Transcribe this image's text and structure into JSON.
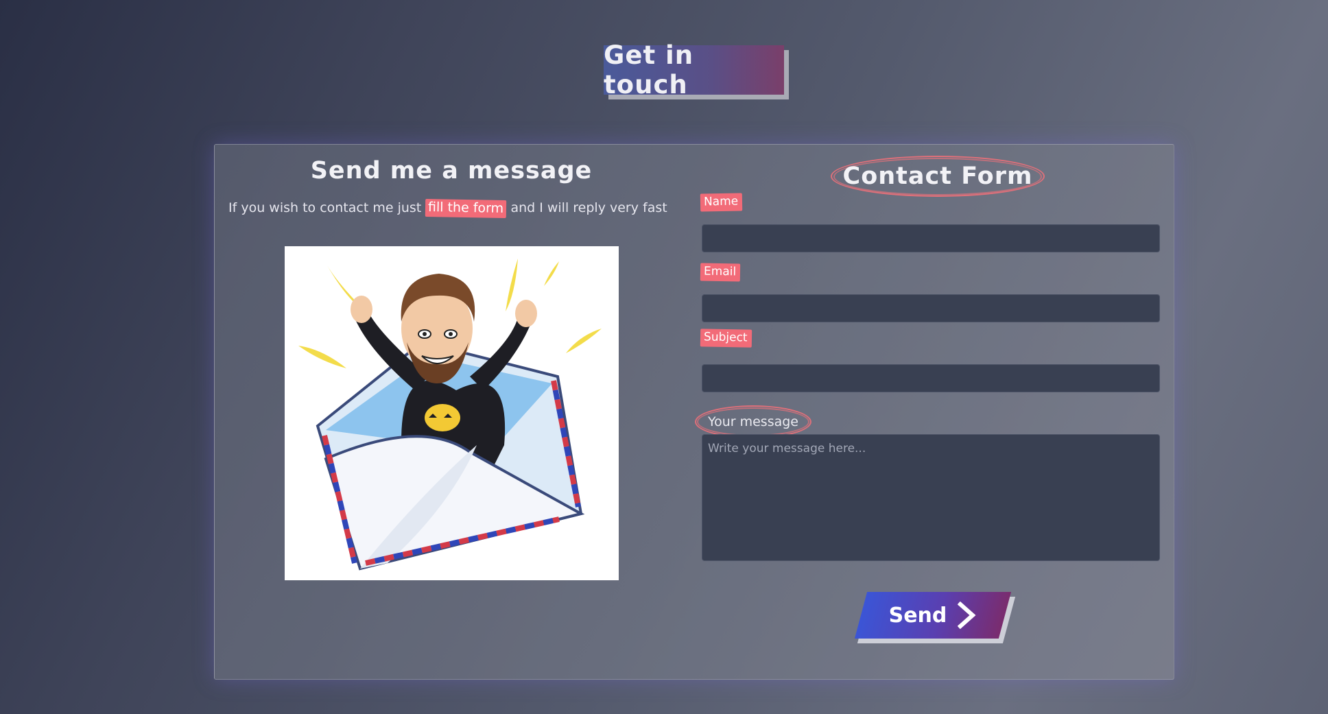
{
  "header": {
    "title": "Get in touch"
  },
  "left": {
    "heading": "Send me a message",
    "intro_before": "If you wish to contact me just",
    "intro_highlight": "fill the form",
    "intro_after": "and I will reply very fast",
    "image_icon": "bitmoji-envelope-illustration"
  },
  "form": {
    "title": "Contact Form",
    "name_label": "Name",
    "name_value": "",
    "email_label": "Email",
    "email_value": "",
    "subject_label": "Subject",
    "subject_value": "",
    "message_label": "Your message",
    "message_placeholder": "Write your message here...",
    "send_label": "Send",
    "send_icon": "chevron-right-icon"
  },
  "colors": {
    "accent_tag": "#f26b78",
    "field_bg": "#394052",
    "button_start": "#3b55d6",
    "button_end": "#7a2c6e"
  }
}
